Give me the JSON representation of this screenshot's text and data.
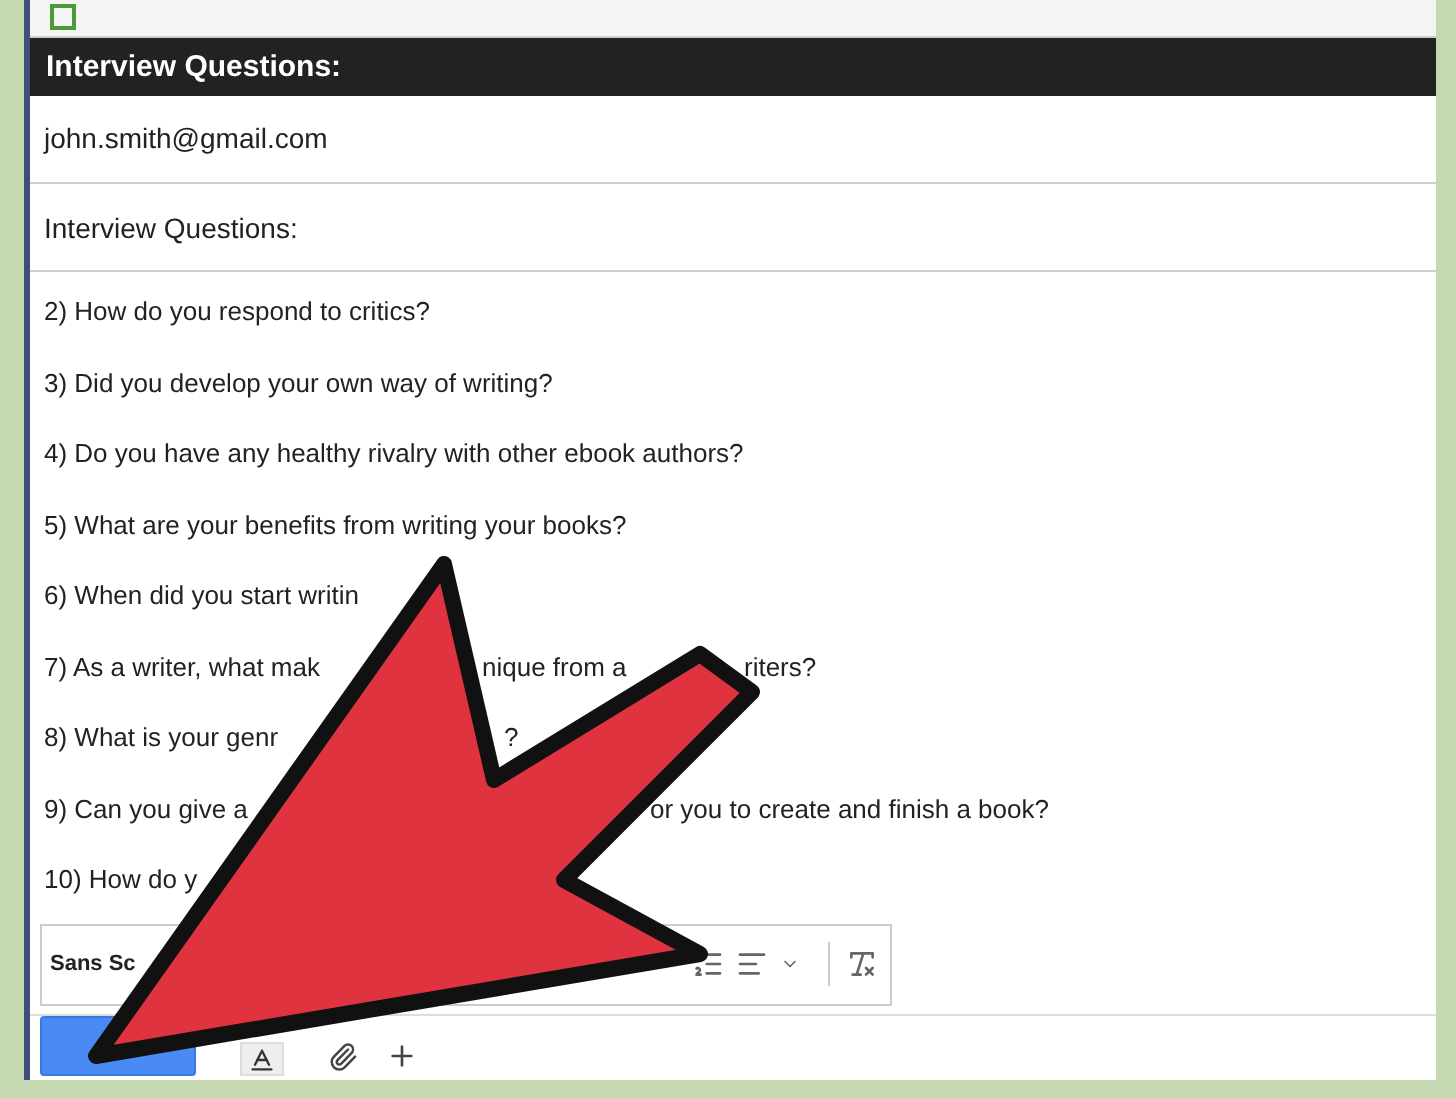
{
  "compose": {
    "title": "Interview Questions:",
    "recipient": "john.smith@gmail.com",
    "subject": "Interview Questions:"
  },
  "body": {
    "lines": [
      {
        "parts": [
          "2) How do you respond to critics?"
        ]
      },
      {
        "parts": [
          "3) Did you develop your own way of writing?"
        ]
      },
      {
        "parts": [
          "4) Do you have any healthy rivalry with other ebook authors?"
        ]
      },
      {
        "parts": [
          "5) What are your benefits from writing your books?"
        ]
      },
      {
        "parts": [
          "6) When did you start writin"
        ]
      },
      {
        "parts": [
          "7) As a writer, what mak",
          "nique from a",
          "riters?"
        ]
      },
      {
        "parts": [
          "8) What is your genr",
          "?"
        ]
      },
      {
        "parts": [
          "9) Can you give a",
          "or you to create and finish a book?"
        ]
      },
      {
        "parts": [
          "10) How do y"
        ]
      }
    ]
  },
  "format_toolbar": {
    "font": "Sans Sc"
  }
}
